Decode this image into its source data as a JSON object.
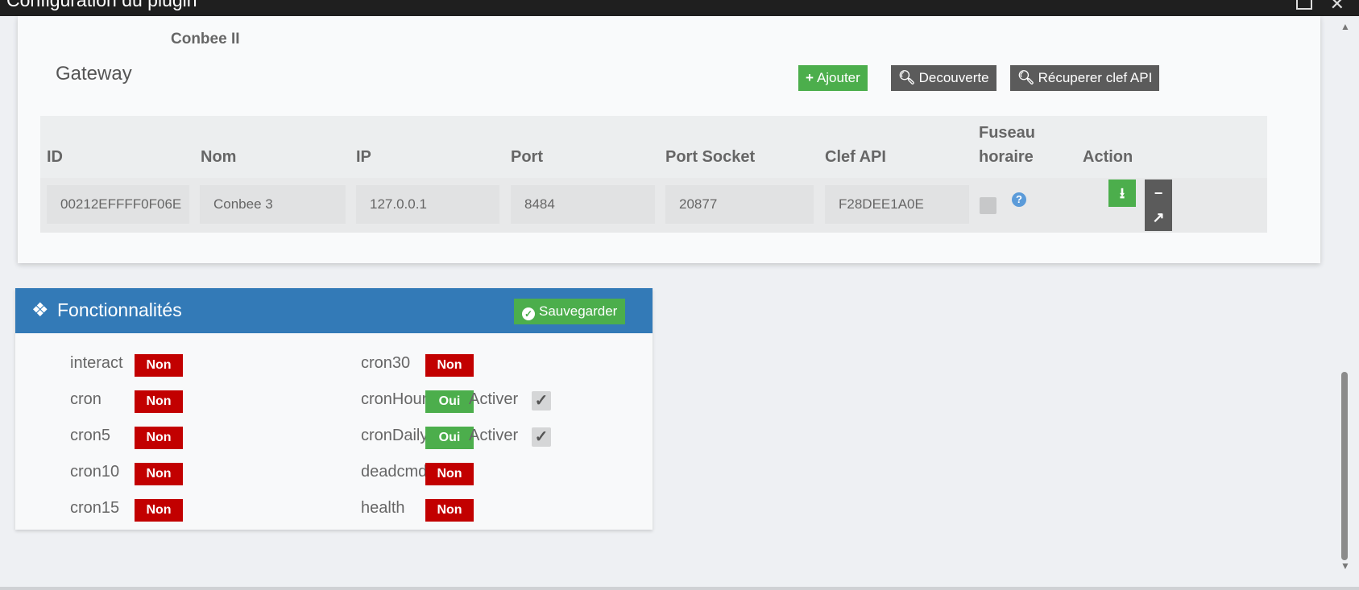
{
  "window": {
    "title": "Configuration du plugin"
  },
  "gateway_section": {
    "device_label": "Conbee II",
    "title": "Gateway",
    "buttons": {
      "add": "Ajouter",
      "discover": "Decouverte",
      "get_api_key": "Récuperer clef API"
    },
    "table": {
      "headers": {
        "id": "ID",
        "name": "Nom",
        "ip": "IP",
        "port": "Port",
        "port_socket": "Port Socket",
        "api_key": "Clef API",
        "timezone_line1": "Fuseau",
        "timezone_line2": "horaire",
        "action": "Action"
      },
      "row": {
        "id": "00212EFFFF0F06E",
        "name": "Conbee 3",
        "ip": "127.0.0.1",
        "port": "8484",
        "port_socket": "20877",
        "api_key": "F28DEE1A0E",
        "timezone_checked": false
      }
    }
  },
  "features_section": {
    "title": "Fonctionnalités",
    "save_label": "Sauvegarder",
    "left": [
      {
        "name": "interact",
        "status": "Non"
      },
      {
        "name": "cron",
        "status": "Non"
      },
      {
        "name": "cron5",
        "status": "Non"
      },
      {
        "name": "cron10",
        "status": "Non"
      },
      {
        "name": "cron15",
        "status": "Non"
      }
    ],
    "right": [
      {
        "name": "cron30",
        "status": "Non"
      },
      {
        "name": "cronHourly",
        "status": "Oui",
        "activate_label": "Activer",
        "activated": true
      },
      {
        "name": "cronDaily",
        "status": "Oui",
        "activate_label": "Activer",
        "activated": true
      },
      {
        "name": "deadcmd",
        "status": "Non"
      },
      {
        "name": "health",
        "status": "Non"
      }
    ]
  },
  "colors": {
    "primary_header": "#337ab7",
    "success": "#4cae4c",
    "danger": "#c20000",
    "dark_button": "#5b5b5b"
  }
}
